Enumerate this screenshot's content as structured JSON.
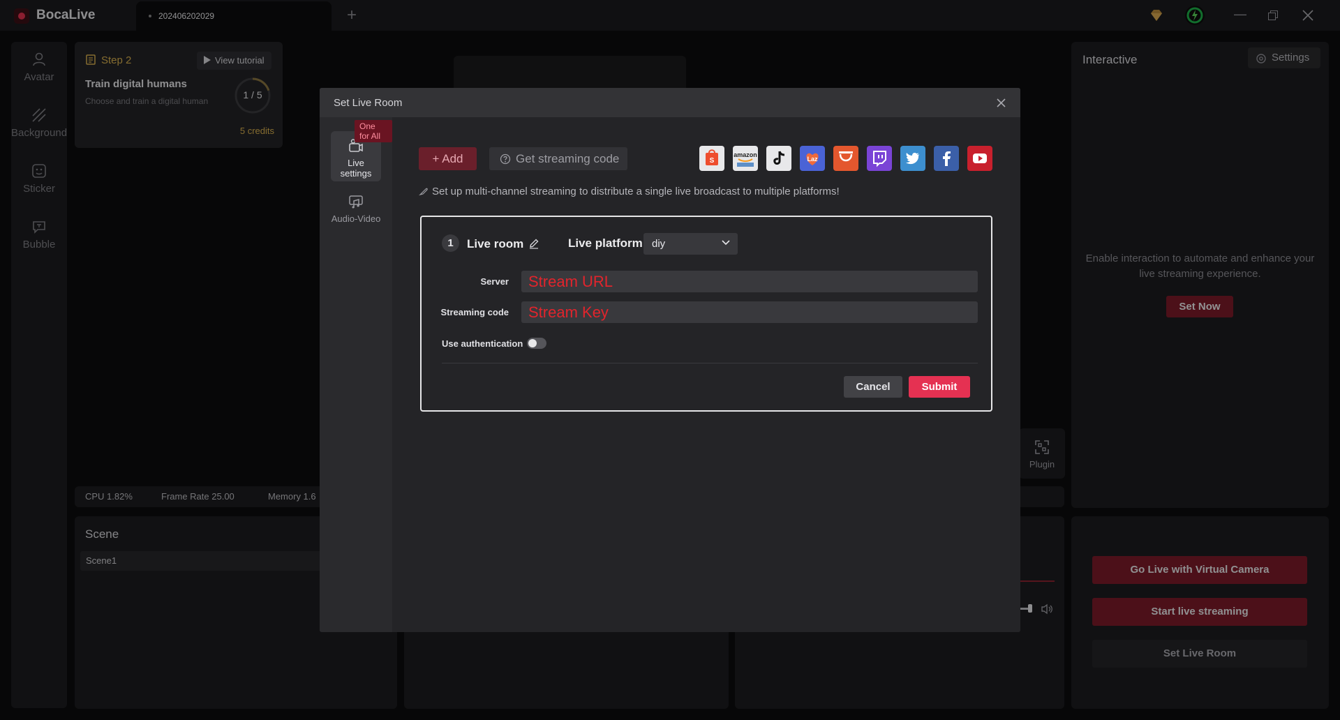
{
  "app": {
    "name": "BocaLive",
    "tab_title": "202406202029"
  },
  "sidebar": {
    "items": [
      {
        "label": "Avatar"
      },
      {
        "label": "Background"
      },
      {
        "label": "Sticker"
      },
      {
        "label": "Bubble"
      }
    ]
  },
  "step": {
    "label": "Step 2",
    "view_tutorial": "View tutorial",
    "title": "Train digital humans",
    "desc": "Choose and train a digital human",
    "progress": "1 / 5",
    "progress_fraction": 0.2,
    "credits": "5 credits"
  },
  "stats": {
    "cpu": "CPU 1.82%",
    "frame_rate": "Frame Rate 25.00",
    "memory": "Memory 1.6"
  },
  "scene": {
    "title": "Scene",
    "items": [
      {
        "label": "Scene1"
      }
    ]
  },
  "plugin": {
    "label": "Plugin"
  },
  "interactive": {
    "title": "Interactive",
    "settings_label": "Settings",
    "description": "Enable interaction to automate and enhance your live streaming experience.",
    "set_now": "Set Now"
  },
  "golive": {
    "virtual_camera": "Go Live with Virtual Camera",
    "start_streaming": "Start live streaming",
    "set_live_room": "Set Live Room"
  },
  "modal": {
    "title": "Set Live Room",
    "nav": {
      "live_settings": "Live settings",
      "audio_video": "Audio-Video",
      "badge": "One for All"
    },
    "add_label": "+ Add",
    "get_code_label": "Get streaming code",
    "platforms": [
      "shopee",
      "amazon",
      "tiktok",
      "lazada",
      "aliexpress",
      "twitch",
      "twitter",
      "facebook",
      "youtube"
    ],
    "tip": "Set up multi-channel streaming to distribute a single live broadcast to multiple platforms!",
    "room": {
      "number": "1",
      "live_room_label": "Live room",
      "platform_label": "Live platform",
      "platform_value": "diy",
      "server_label": "Server",
      "server_value": "Stream URL",
      "code_label": "Streaming code",
      "code_value": "Stream Key",
      "auth_label": "Use authentication",
      "auth_enabled": false,
      "cancel": "Cancel",
      "submit": "Submit"
    }
  },
  "colors": {
    "accent": "#e53152",
    "gold": "#d9b04e",
    "dark_red": "#7b1a29"
  }
}
